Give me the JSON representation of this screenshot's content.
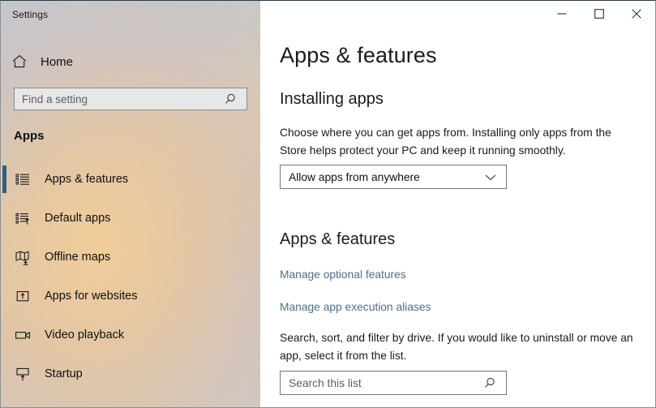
{
  "window": {
    "title": "Settings",
    "controls": {
      "minimize": "minimize",
      "maximize": "maximize",
      "close": "close"
    }
  },
  "sidebar": {
    "home_label": "Home",
    "home_icon": "home-icon",
    "search": {
      "placeholder": "Find a setting",
      "value": "",
      "icon": "search-icon"
    },
    "group_title": "Apps",
    "selection_color": "#2c627f",
    "items": [
      {
        "label": "Apps & features",
        "icon": "list-bullets-icon",
        "active": true
      },
      {
        "label": "Default apps",
        "icon": "list-arrow-icon",
        "active": false
      },
      {
        "label": "Offline maps",
        "icon": "map-download-icon",
        "active": false
      },
      {
        "label": "Apps for websites",
        "icon": "box-arrow-up-icon",
        "active": false
      },
      {
        "label": "Video playback",
        "icon": "video-camera-icon",
        "active": false
      },
      {
        "label": "Startup",
        "icon": "monitor-arrow-up-icon",
        "active": false
      }
    ]
  },
  "main": {
    "page_title": "Apps & features",
    "installing": {
      "heading": "Installing apps",
      "description": "Choose where you can get apps from. Installing only apps from the Store helps protect your PC and keep it running smoothly.",
      "dropdown": {
        "value": "Allow apps from anywhere",
        "icon": "chevron-down-icon"
      }
    },
    "apps_features": {
      "heading": "Apps & features",
      "links": [
        "Manage optional features",
        "Manage app execution aliases"
      ],
      "link_color": "#4d6e8a",
      "description": "Search, sort, and filter by drive. If you would like to uninstall or move an app, select it from the list.",
      "search": {
        "placeholder": "Search this list",
        "value": "",
        "icon": "search-icon"
      }
    }
  }
}
